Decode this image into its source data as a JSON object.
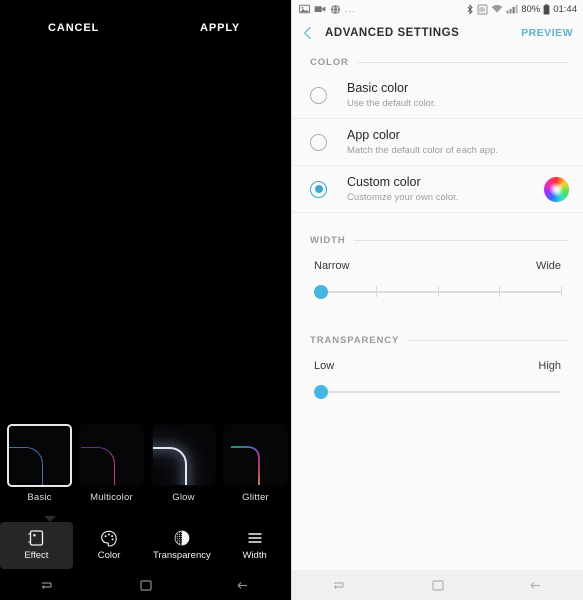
{
  "left_panel": {
    "cancel_label": "CANCEL",
    "apply_label": "APPLY",
    "effects": [
      {
        "label": "Basic",
        "selected": true
      },
      {
        "label": "Multicolor",
        "selected": false
      },
      {
        "label": "Glow",
        "selected": false
      },
      {
        "label": "Glitter",
        "selected": false
      }
    ],
    "modes": [
      {
        "label": "Effect",
        "icon": "effect-frame-icon",
        "selected": true
      },
      {
        "label": "Color",
        "icon": "palette-icon",
        "selected": false
      },
      {
        "label": "Transparency",
        "icon": "half-filled-circle-icon",
        "selected": false
      },
      {
        "label": "Width",
        "icon": "three-lines-icon",
        "selected": false
      }
    ],
    "navigation": [
      {
        "name": "recent-apps",
        "icon": "recents-icon"
      },
      {
        "name": "home",
        "icon": "home-square-icon"
      },
      {
        "name": "back",
        "icon": "back-arrow-icon"
      }
    ]
  },
  "right_panel": {
    "status_bar": {
      "notification_icons": [
        "image-icon",
        "video-icon",
        "globe-icon"
      ],
      "overflow": "...",
      "system_icons": [
        "bluetooth-icon",
        "nfc-icon",
        "wifi-icon",
        "signal-icon"
      ],
      "battery_percent": "80%",
      "battery_icon": "battery-icon",
      "clock": "01:44"
    },
    "app_bar": {
      "back_icon": "back-chevron-icon",
      "title": "ADVANCED SETTINGS",
      "preview_label": "PREVIEW"
    },
    "sections": {
      "color": {
        "heading": "COLOR",
        "options": [
          {
            "title": "Basic color",
            "subtitle": "Use the default color.",
            "selected": false,
            "has_color_wheel": false
          },
          {
            "title": "App color",
            "subtitle": "Match the default color of each app.",
            "selected": false,
            "has_color_wheel": false
          },
          {
            "title": "Custom color",
            "subtitle": "Customize your own color.",
            "selected": true,
            "has_color_wheel": true
          }
        ]
      },
      "width": {
        "heading": "WIDTH",
        "min_label": "Narrow",
        "max_label": "Wide",
        "value_percent": 0,
        "ticks": 5
      },
      "transparency": {
        "heading": "TRANSPARENCY",
        "min_label": "Low",
        "max_label": "High",
        "value_percent": 0,
        "ticks": 0
      }
    },
    "navigation": [
      {
        "name": "recent-apps",
        "icon": "recents-icon"
      },
      {
        "name": "home",
        "icon": "home-square-icon"
      },
      {
        "name": "back",
        "icon": "back-arrow-icon"
      }
    ],
    "colors": {
      "accent": "#3fa9c9",
      "slider_thumb": "#45b6e0",
      "preview_link": "#5fb3c4",
      "background": "#fafafa"
    }
  }
}
